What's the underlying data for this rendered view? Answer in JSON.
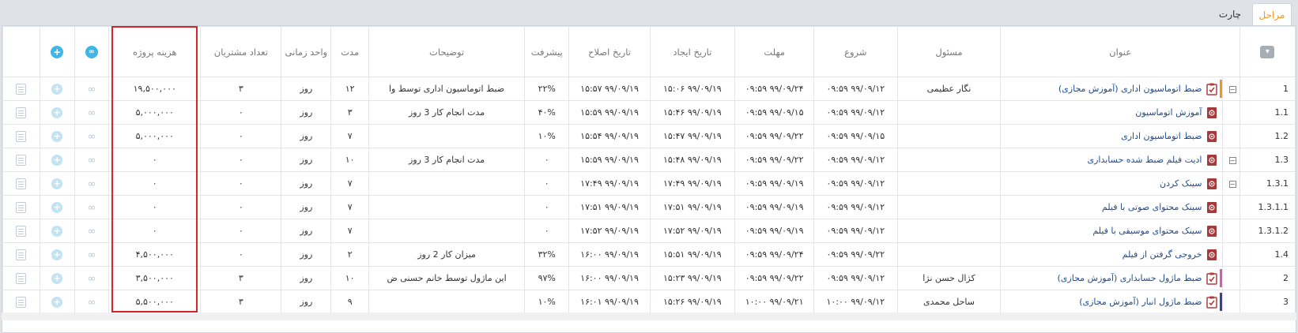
{
  "tabs": [
    {
      "label": "مراحل",
      "active": true
    },
    {
      "label": "چارت",
      "active": false
    }
  ],
  "columns": {
    "title": "عنوان",
    "owner": "مسئول",
    "start": "شروع",
    "deadline": "مهلت",
    "created": "تاریخ ایجاد",
    "modified": "تاریخ اصلاح",
    "progress": "پیشرفت",
    "description": "توضیحات",
    "duration": "مدت",
    "time_unit": "واحد زمانی",
    "customers": "تعداد مشتریان",
    "cost": "هزینه پروژه",
    "menu_icon": "▾",
    "add_icon": "+",
    "link_icon": "∞"
  },
  "colors": {
    "accent": "#f0961d",
    "link": "#1f4c8f",
    "highlight": "#d9232a"
  },
  "rows": [
    {
      "id": "1",
      "title": "ضبط اتوماسیون اداری (آموزش مجازی)",
      "owner": "نگار عظیمی",
      "start": "۹۹/۰۹/۱۲ ۰۹:۵۹",
      "deadline": "۹۹/۰۹/۲۴ ۰۹:۵۹",
      "created": "۹۹/۰۹/۱۹ ۱۵:۰۶",
      "modified": "۹۹/۰۹/۱۹ ۱۵:۵۷",
      "progress": "۲۲%",
      "description": "ضبط اتوماسیون اداری توسط وا",
      "duration": "۱۲",
      "time_unit": "روز",
      "customers": "۳",
      "cost": "۱۹,۵۰۰,۰۰۰",
      "icon": "task",
      "toggle": "−",
      "bar": "#f0961d"
    },
    {
      "id": "1.1",
      "title": "آموزش اتوماسیون",
      "owner": "",
      "start": "۹۹/۰۹/۱۲ ۰۹:۵۹",
      "deadline": "۹۹/۰۹/۱۵ ۰۹:۵۹",
      "created": "۹۹/۰۹/۱۹ ۱۵:۴۶",
      "modified": "۹۹/۰۹/۱۹ ۱۵:۵۹",
      "progress": "۴۰%",
      "description": "مدت انجام کار 3 روز",
      "duration": "۳",
      "time_unit": "روز",
      "customers": "۰",
      "cost": "۵,۰۰۰,۰۰۰",
      "icon": "sub",
      "toggle": "",
      "bar": ""
    },
    {
      "id": "1.2",
      "title": "ضبط اتوماسیون اداری",
      "owner": "",
      "start": "۹۹/۰۹/۱۵ ۰۹:۵۹",
      "deadline": "۹۹/۰۹/۲۲ ۰۹:۵۹",
      "created": "۹۹/۰۹/۱۹ ۱۵:۴۷",
      "modified": "۹۹/۰۹/۱۹ ۱۵:۵۴",
      "progress": "۱۰%",
      "description": "",
      "duration": "۷",
      "time_unit": "روز",
      "customers": "۰",
      "cost": "۵,۰۰۰,۰۰۰",
      "icon": "sub",
      "toggle": "",
      "bar": ""
    },
    {
      "id": "1.3",
      "title": "ادیت فیلم ضبط شده حسابداری",
      "owner": "",
      "start": "۹۹/۰۹/۱۲ ۰۹:۵۹",
      "deadline": "۹۹/۰۹/۲۲ ۰۹:۵۹",
      "created": "۹۹/۰۹/۱۹ ۱۵:۴۸",
      "modified": "۹۹/۰۹/۱۹ ۱۵:۵۹",
      "progress": "۰",
      "description": "مدت انجام کار 3 روز",
      "duration": "۱۰",
      "time_unit": "روز",
      "customers": "۰",
      "cost": "۰",
      "icon": "sub",
      "toggle": "−",
      "bar": ""
    },
    {
      "id": "1.3.1",
      "title": "سینک کردن",
      "owner": "",
      "start": "۹۹/۰۹/۱۲ ۰۹:۵۹",
      "deadline": "۹۹/۰۹/۱۹ ۰۹:۵۹",
      "created": "۹۹/۰۹/۱۹ ۱۷:۴۹",
      "modified": "۹۹/۰۹/۱۹ ۱۷:۴۹",
      "progress": "۰",
      "description": "",
      "duration": "۷",
      "time_unit": "روز",
      "customers": "۰",
      "cost": "۰",
      "icon": "sub",
      "toggle": "−",
      "bar": ""
    },
    {
      "id": "1.3.1.1",
      "title": "سینک محتوای صوتی با فیلم",
      "owner": "",
      "start": "۹۹/۰۹/۱۲ ۰۹:۵۹",
      "deadline": "۹۹/۰۹/۱۹ ۰۹:۵۹",
      "created": "۹۹/۰۹/۱۹ ۱۷:۵۱",
      "modified": "۹۹/۰۹/۱۹ ۱۷:۵۱",
      "progress": "۰",
      "description": "",
      "duration": "۷",
      "time_unit": "روز",
      "customers": "۰",
      "cost": "۰",
      "icon": "sub",
      "toggle": "",
      "bar": ""
    },
    {
      "id": "1.3.1.2",
      "title": "سینک محتوای موسیقی با فیلم",
      "owner": "",
      "start": "۹۹/۰۹/۱۲ ۰۹:۵۹",
      "deadline": "۹۹/۰۹/۱۹ ۰۹:۵۹",
      "created": "۹۹/۰۹/۱۹ ۱۷:۵۲",
      "modified": "۹۹/۰۹/۱۹ ۱۷:۵۲",
      "progress": "۰",
      "description": "",
      "duration": "۷",
      "time_unit": "روز",
      "customers": "۰",
      "cost": "۰",
      "icon": "sub",
      "toggle": "",
      "bar": ""
    },
    {
      "id": "1.4",
      "title": "خروجی گرفتن از فیلم",
      "owner": "",
      "start": "۹۹/۰۹/۲۲ ۰۹:۵۹",
      "deadline": "۹۹/۰۹/۲۴ ۰۹:۵۹",
      "created": "۹۹/۰۹/۱۹ ۱۵:۵۱",
      "modified": "۹۹/۰۹/۱۹ ۱۶:۰۰",
      "progress": "۳۲%",
      "description": "میزان کار 2 روز",
      "duration": "۲",
      "time_unit": "روز",
      "customers": "۰",
      "cost": "۴,۵۰۰,۰۰۰",
      "icon": "sub",
      "toggle": "",
      "bar": ""
    },
    {
      "id": "2",
      "title": "ضبط ماژول حسابداری (آموزش مجازی)",
      "owner": "کژال حسن نژا",
      "start": "۹۹/۰۹/۱۲ ۰۹:۵۹",
      "deadline": "۹۹/۰۹/۲۲ ۰۹:۵۹",
      "created": "۹۹/۰۹/۱۹ ۱۵:۲۳",
      "modified": "۹۹/۰۹/۱۹ ۱۶:۰۰",
      "progress": "۹۷%",
      "description": "این ماژول توسط خانم حسنی ض",
      "duration": "۱۰",
      "time_unit": "روز",
      "customers": "۳",
      "cost": "۳,۵۰۰,۰۰۰",
      "icon": "task",
      "toggle": "",
      "bar": "#d35db0"
    },
    {
      "id": "3",
      "title": "ضبط ماژول انبار (آموزش مجازی)",
      "owner": "ساحل محمدی",
      "start": "۹۹/۰۹/۱۲ ۱۰:۰۰",
      "deadline": "۹۹/۰۹/۲۱ ۱۰:۰۰",
      "created": "۹۹/۰۹/۱۹ ۱۵:۲۶",
      "modified": "۹۹/۰۹/۱۹ ۱۶:۰۱",
      "progress": "۱۰%",
      "description": "",
      "duration": "۹",
      "time_unit": "روز",
      "customers": "۳",
      "cost": "۵,۵۰۰,۰۰۰",
      "icon": "task",
      "toggle": "",
      "bar": "#3b3f99"
    }
  ]
}
